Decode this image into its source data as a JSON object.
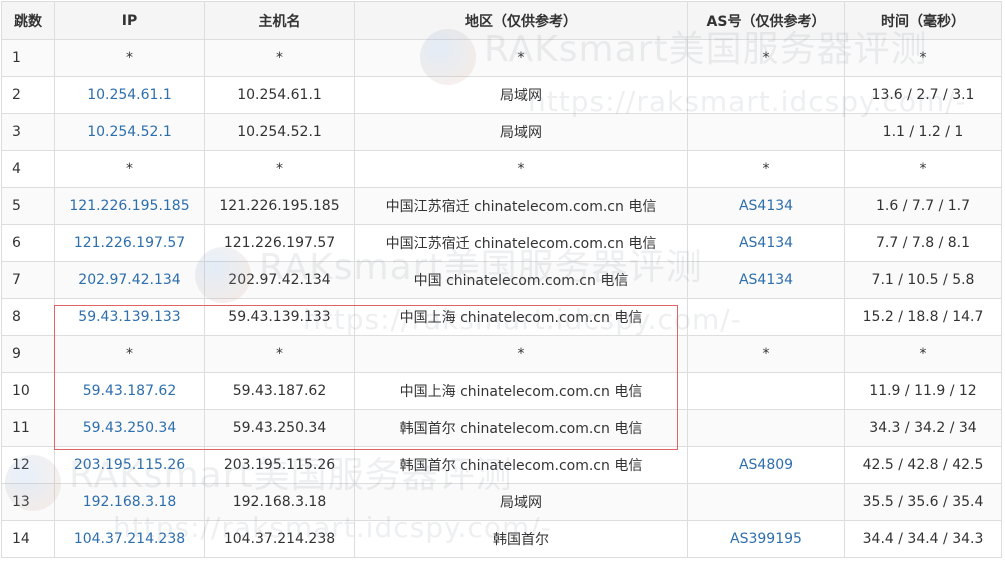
{
  "table": {
    "headers": [
      "跳数",
      "IP",
      "主机名",
      "地区（仅供参考）",
      "AS号（仅供参考）",
      "时间（毫秒）"
    ],
    "rows": [
      {
        "hop": "1",
        "ip": "*",
        "ip_link": false,
        "host": "*",
        "region": "*",
        "asn": "*",
        "asn_link": false,
        "time": "*"
      },
      {
        "hop": "2",
        "ip": "10.254.61.1",
        "ip_link": true,
        "host": "10.254.61.1",
        "region": "局域网",
        "asn": "",
        "asn_link": false,
        "time": "13.6 / 2.7 / 3.1"
      },
      {
        "hop": "3",
        "ip": "10.254.52.1",
        "ip_link": true,
        "host": "10.254.52.1",
        "region": "局域网",
        "asn": "",
        "asn_link": false,
        "time": "1.1 / 1.2 / 1"
      },
      {
        "hop": "4",
        "ip": "*",
        "ip_link": false,
        "host": "*",
        "region": "*",
        "asn": "*",
        "asn_link": false,
        "time": "*"
      },
      {
        "hop": "5",
        "ip": "121.226.195.185",
        "ip_link": true,
        "host": "121.226.195.185",
        "region": "中国江苏宿迁 chinatelecom.com.cn 电信",
        "asn": "AS4134",
        "asn_link": true,
        "time": "1.6 / 7.7 / 1.7"
      },
      {
        "hop": "6",
        "ip": "121.226.197.57",
        "ip_link": true,
        "host": "121.226.197.57",
        "region": "中国江苏宿迁 chinatelecom.com.cn 电信",
        "asn": "AS4134",
        "asn_link": true,
        "time": "7.7 / 7.8 / 8.1"
      },
      {
        "hop": "7",
        "ip": "202.97.42.134",
        "ip_link": true,
        "host": "202.97.42.134",
        "region": "中国 chinatelecom.com.cn 电信",
        "asn": "AS4134",
        "asn_link": true,
        "time": "7.1 / 10.5 / 5.8"
      },
      {
        "hop": "8",
        "ip": "59.43.139.133",
        "ip_link": true,
        "host": "59.43.139.133",
        "region": "中国上海 chinatelecom.com.cn 电信",
        "asn": "",
        "asn_link": false,
        "time": "15.2 / 18.8 / 14.7"
      },
      {
        "hop": "9",
        "ip": "*",
        "ip_link": false,
        "host": "*",
        "region": "*",
        "asn": "*",
        "asn_link": false,
        "time": "*"
      },
      {
        "hop": "10",
        "ip": "59.43.187.62",
        "ip_link": true,
        "host": "59.43.187.62",
        "region": "中国上海 chinatelecom.com.cn 电信",
        "asn": "",
        "asn_link": false,
        "time": "11.9 / 11.9 / 12"
      },
      {
        "hop": "11",
        "ip": "59.43.250.34",
        "ip_link": true,
        "host": "59.43.250.34",
        "region": "韩国首尔 chinatelecom.com.cn 电信",
        "asn": "",
        "asn_link": false,
        "time": "34.3 / 34.2 / 34"
      },
      {
        "hop": "12",
        "ip": "203.195.115.26",
        "ip_link": true,
        "host": "203.195.115.26",
        "region": "韩国首尔 chinatelecom.com.cn 电信",
        "asn": "AS4809",
        "asn_link": true,
        "time": "42.5 / 42.8 / 42.5"
      },
      {
        "hop": "13",
        "ip": "192.168.3.18",
        "ip_link": true,
        "host": "192.168.3.18",
        "region": "局域网",
        "asn": "",
        "asn_link": false,
        "time": "35.5 / 35.6 / 35.4"
      },
      {
        "hop": "14",
        "ip": "104.37.214.238",
        "ip_link": true,
        "host": "104.37.214.238",
        "region": "韩国首尔",
        "asn": "AS399195",
        "asn_link": true,
        "time": "34.4 / 34.4 / 34.3"
      }
    ]
  },
  "watermark": {
    "title": "RAKsmart美国服务器评测",
    "url": "https://raksmart.idcspy.com/-"
  },
  "colors": {
    "link": "#2d6ead",
    "highlight_border": "#e06464",
    "header_bg": "#f5f5f5",
    "border": "#dddddd"
  }
}
